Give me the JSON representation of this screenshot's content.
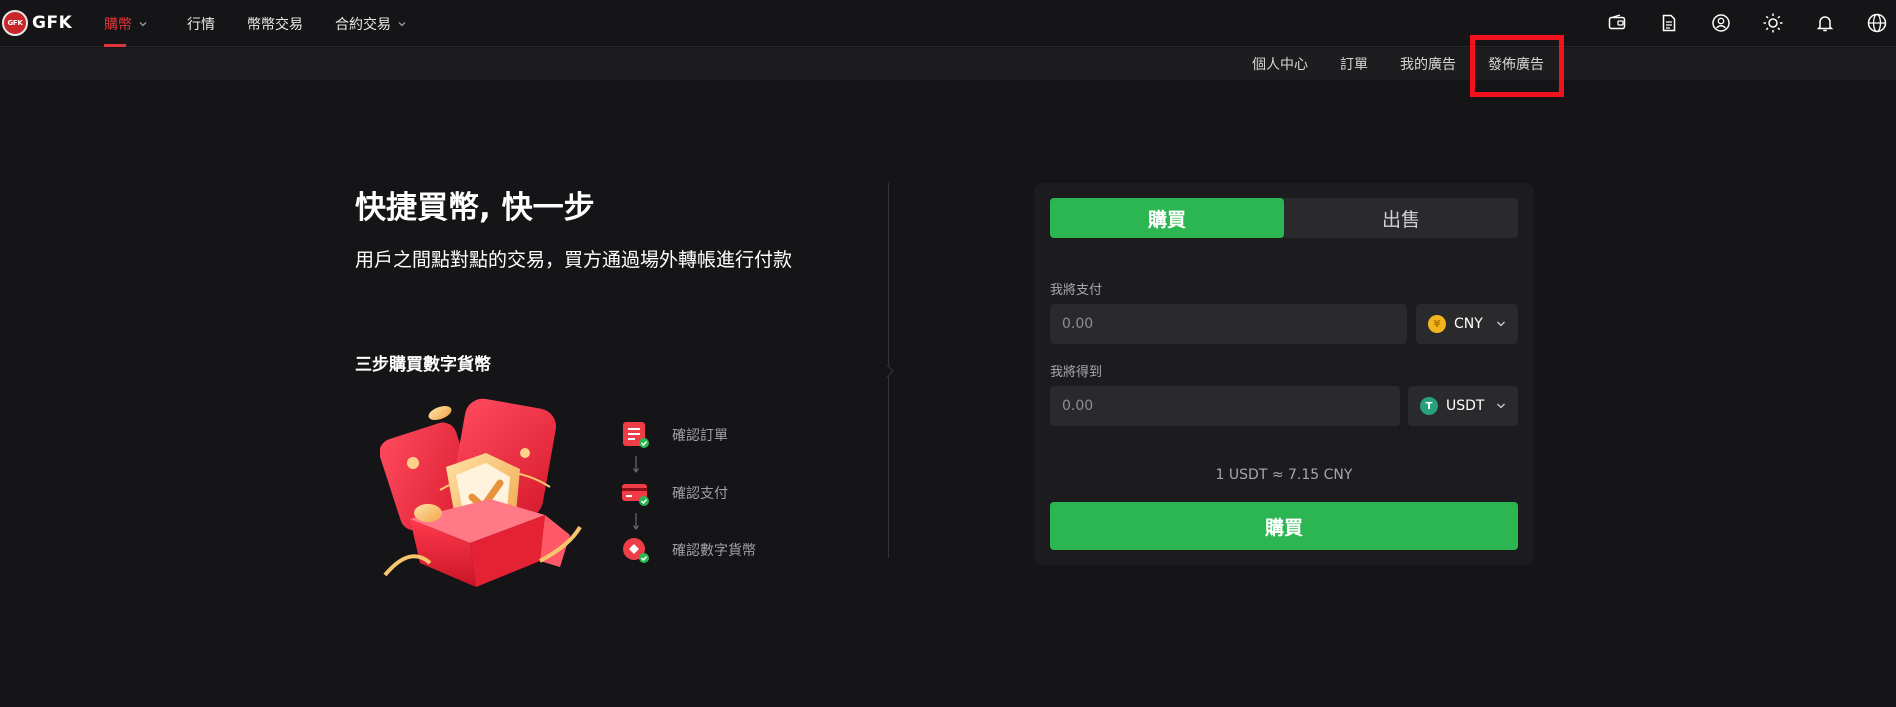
{
  "brand": {
    "logo_mark": "GFK",
    "logo_text": "GFK"
  },
  "topnav": {
    "items": [
      {
        "label": "購幣",
        "active": true,
        "has_dropdown": true
      },
      {
        "label": "行情",
        "active": false,
        "has_dropdown": false
      },
      {
        "label": "幣幣交易",
        "active": false,
        "has_dropdown": false
      },
      {
        "label": "合約交易",
        "active": false,
        "has_dropdown": true
      }
    ],
    "icons": [
      "wallet-icon",
      "document-icon",
      "user-icon",
      "sun-icon",
      "bell-icon",
      "globe-icon"
    ]
  },
  "subnav": {
    "items": [
      "個人中心",
      "訂單",
      "我的廣告",
      "發佈廣告"
    ]
  },
  "hero": {
    "title": "快捷買幣, 快一步",
    "subtitle": "用戶之間點對點的交易，買方通過場外轉帳進行付款"
  },
  "steps": {
    "title": "三步購買數字貨幣",
    "items": [
      {
        "label": "確認訂單",
        "icon": "order-icon"
      },
      {
        "label": "確認支付",
        "icon": "card-icon"
      },
      {
        "label": "確認數字貨幣",
        "icon": "coin-icon"
      }
    ]
  },
  "trade": {
    "tab_buy": "購買",
    "tab_sell": "出售",
    "pay_label": "我將支付",
    "pay_placeholder": "0.00",
    "pay_currency": "CNY",
    "receive_label": "我將得到",
    "receive_placeholder": "0.00",
    "receive_currency": "USDT",
    "rate": "1 USDT ≈ 7.15 CNY",
    "submit": "購買"
  },
  "colors": {
    "accent_red": "#e0353b",
    "accent_green": "#2cb652",
    "highlight": "#f0121c",
    "background": "#151517"
  }
}
